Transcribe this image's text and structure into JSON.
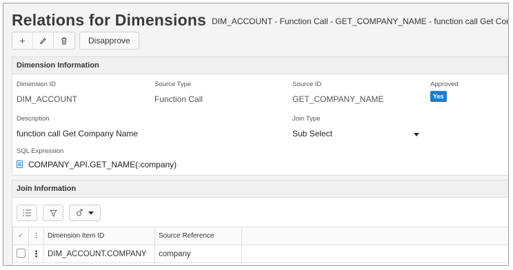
{
  "header": {
    "title": "Relations for Dimensions",
    "subtitle": "DIM_ACCOUNT - Function Call - GET_COMPANY_NAME - function call Get Company Name"
  },
  "toolbar": {
    "add_icon": "+",
    "edit_icon": "pencil-icon",
    "delete_icon": "trash-icon",
    "disapprove_label": "Disapprove"
  },
  "dimension_info": {
    "heading": "Dimension Information",
    "dimension_id": {
      "label": "Dimension ID",
      "value": "DIM_ACCOUNT"
    },
    "source_type": {
      "label": "Source Type",
      "value": "Function Call"
    },
    "source_id": {
      "label": "Source ID",
      "value": "GET_COMPANY_NAME"
    },
    "approved": {
      "label": "Approved",
      "value": "Yes"
    },
    "description": {
      "label": "Description",
      "value": "function call Get Company Name"
    },
    "join_type": {
      "label": "Join Type",
      "value": "Sub Select"
    },
    "sql_expression": {
      "label": "SQL Expression",
      "value": "COMPANY_API.GET_NAME(:company)"
    }
  },
  "join_info": {
    "heading": "Join Information",
    "columns": {
      "check": "✓",
      "menu": "⋮",
      "item_id": "Dimension Item ID",
      "source_ref": "Source Reference"
    },
    "rows": [
      {
        "item_id": "DIM_ACCOUNT.COMPANY",
        "source_ref": "company"
      }
    ]
  },
  "colors": {
    "accent": "#1e7fc7",
    "panel_header": "#f0f0f0"
  }
}
